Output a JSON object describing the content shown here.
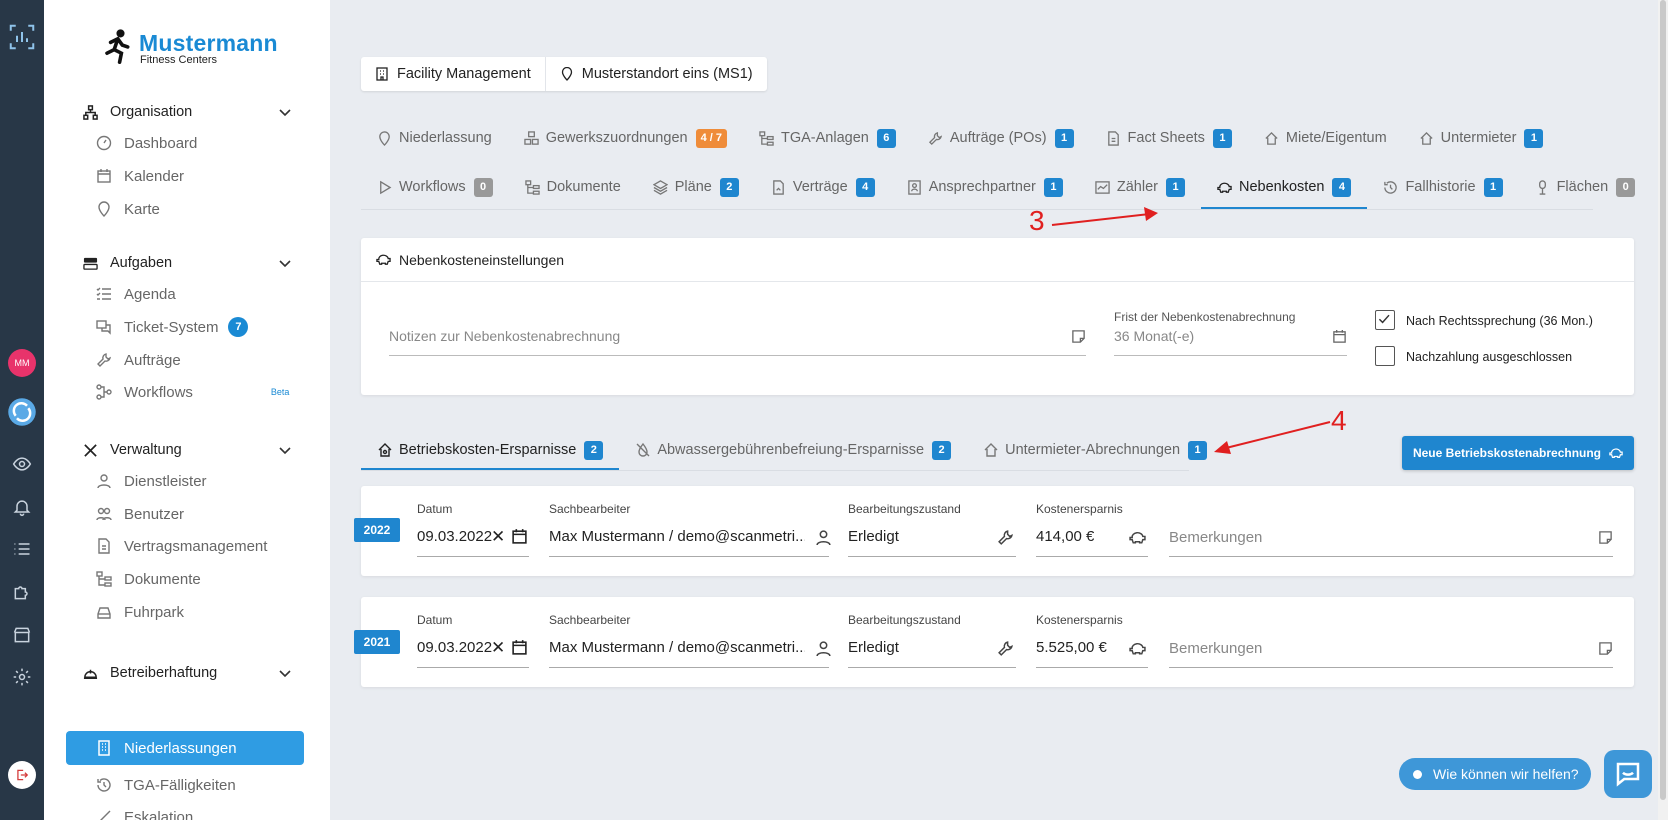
{
  "brand": {
    "name": "Mustermann",
    "subtitle": "Fitness Centers"
  },
  "rail": {
    "avatar_initials": "MM"
  },
  "sidebar": {
    "groups": [
      {
        "label": "Organisation",
        "items": [
          "Dashboard",
          "Kalender",
          "Karte"
        ]
      },
      {
        "label": "Aufgaben",
        "items": [
          "Agenda",
          "Ticket-System",
          "Aufträge",
          "Workflows"
        ],
        "ticket_badge": "7",
        "beta_label": "Beta"
      },
      {
        "label": "Verwaltung",
        "items": [
          "Dienstleister",
          "Benutzer",
          "Vertragsmanagement",
          "Dokumente",
          "Fuhrpark"
        ]
      },
      {
        "label": "Betreiberhaftung",
        "items": [
          "Niederlassungen",
          "TGA-Fälligkeiten",
          "Eskalation"
        ]
      }
    ]
  },
  "chips": [
    "Facility Management",
    "Musterstandort eins (MS1)"
  ],
  "tabs_row1": [
    {
      "label": "Niederlassung",
      "count": ""
    },
    {
      "label": "Gewerkszuordnungen",
      "count": "4 / 7"
    },
    {
      "label": "TGA-Anlagen",
      "count": "6"
    },
    {
      "label": "Aufträge (POs)",
      "count": "1"
    },
    {
      "label": "Fact Sheets",
      "count": "1"
    },
    {
      "label": "Miete/Eigentum",
      "count": ""
    },
    {
      "label": "Untermieter",
      "count": "1"
    }
  ],
  "tabs_row2": [
    {
      "label": "Workflows",
      "count": "0"
    },
    {
      "label": "Dokumente",
      "count": ""
    },
    {
      "label": "Pläne",
      "count": "2"
    },
    {
      "label": "Verträge",
      "count": "4"
    },
    {
      "label": "Ansprechpartner",
      "count": "1"
    },
    {
      "label": "Zähler",
      "count": "1"
    },
    {
      "label": "Nebenkosten",
      "count": "4"
    },
    {
      "label": "Fallhistorie",
      "count": "1"
    },
    {
      "label": "Flächen",
      "count": "0"
    }
  ],
  "settings": {
    "title": "Nebenkosteneinstellungen",
    "notes_placeholder": "Notizen zur Nebenkostenabrechnung",
    "deadline_label": "Frist der Nebenkostenabrechnung",
    "deadline_value": "36 Monat(-e)",
    "check1_label": "Nach Rechtssprechung (36 Mon.)",
    "check2_label": "Nachzahlung ausgeschlossen"
  },
  "subtabs": [
    {
      "label": "Betriebskosten-Ersparnisse",
      "count": "2"
    },
    {
      "label": "Abwassergebührenbefreiung-Ersparnisse",
      "count": "2"
    },
    {
      "label": "Untermieter-Abrechnungen",
      "count": "1"
    }
  ],
  "new_button": "Neue Betriebskostenabrechnung",
  "columns": {
    "date": "Datum",
    "clerk": "Sachbearbeiter",
    "status": "Bearbeitungszustand",
    "savings": "Kostenersparnis",
    "remarks": "Bemerkungen"
  },
  "rows": [
    {
      "year": "2022",
      "date": "09.03.2022",
      "clerk": "Max Mustermann / demo@scanmetri...",
      "status": "Erledigt",
      "savings": "414,00 €"
    },
    {
      "year": "2021",
      "date": "09.03.2022",
      "clerk": "Max Mustermann / demo@scanmetri...",
      "status": "Erledigt",
      "savings": "5.525,00 €"
    }
  ],
  "annotations": [
    "3",
    "4"
  ],
  "help_text": "Wie können wir helfen?",
  "colors": {
    "accent": "#1f86cf",
    "rail": "#283747",
    "annotation": "#e02020",
    "warning_badge": "#ef8c3a"
  }
}
